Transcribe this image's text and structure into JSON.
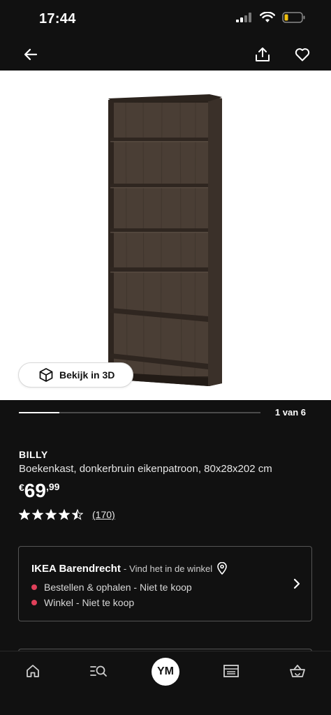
{
  "status_bar": {
    "time": "17:44"
  },
  "header": {
    "back_icon": "arrow-left-icon",
    "share_icon": "share-icon",
    "favorite_icon": "heart-outline-icon"
  },
  "gallery": {
    "view_3d_label": "Bekijk in 3D",
    "page_counter": "1 van 6",
    "current_page": 1,
    "total_pages": 6
  },
  "product": {
    "name": "BILLY",
    "description": "Boekenkast, donkerbruin eikenpatroon, 80x28x202 cm",
    "price_currency": "€",
    "price_integer": "69",
    "price_decimal": ",99",
    "rating": 4.5,
    "rating_max": 5,
    "review_count": "(170)"
  },
  "store": {
    "name": "IKEA Barendrecht",
    "separator": "-",
    "find_text": "Vind het in de winkel",
    "availability": [
      {
        "label": "Bestellen & ophalen - Niet te koop",
        "status_color": "#e0405a"
      },
      {
        "label": "Winkel - Niet te koop",
        "status_color": "#e0405a"
      }
    ]
  },
  "bottom_nav": {
    "items": [
      "home-icon",
      "search-list-icon",
      "profile-avatar",
      "store-icon",
      "basket-icon"
    ],
    "avatar_initials": "YM"
  },
  "colors": {
    "background": "#111111",
    "accent_dot": "#e0405a",
    "text": "#ffffff"
  }
}
